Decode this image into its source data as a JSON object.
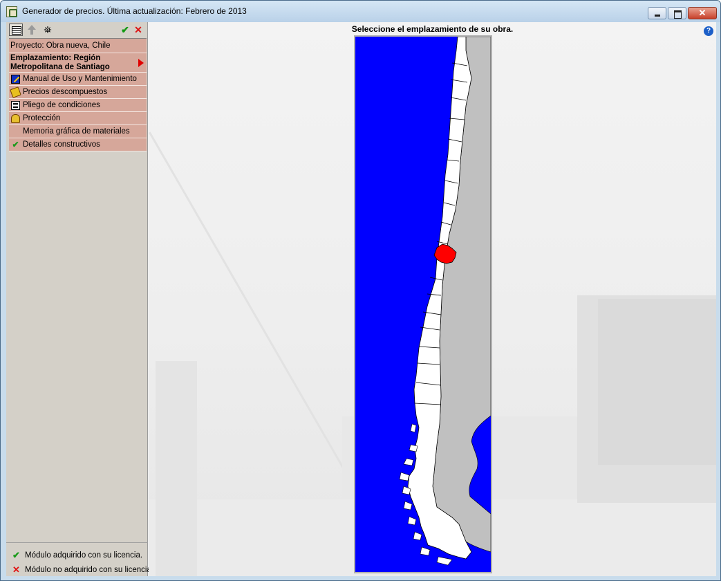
{
  "window": {
    "title": "Generador de precios. Última actualización: Febrero de 2013",
    "close_label": "✕"
  },
  "toolbar": {
    "find_glyph": "⛯",
    "ok_glyph": "✔",
    "cancel_glyph": "✕"
  },
  "menu": {
    "proyecto": "Proyecto: Obra nueva, Chile",
    "emplazamiento": "Emplazamiento: Región Metropolitana de Santiago",
    "items": [
      {
        "label": "Manual de Uso y Mantenimiento",
        "icon": "manual-icon"
      },
      {
        "label": "Precios descompuestos",
        "icon": "price-tag-icon"
      },
      {
        "label": "Pliego de condiciones",
        "icon": "document-icon"
      },
      {
        "label": "Protección",
        "icon": "helmet-icon"
      },
      {
        "label": "Memoria gráfica de materiales",
        "icon": ""
      },
      {
        "label": "Detalles constructivos",
        "icon": "check-icon"
      }
    ]
  },
  "legend": {
    "acquired": "Módulo adquirido con su licencia.",
    "not_acquired": "Módulo no adquirido con su licencia.",
    "acquired_symbol": "✔",
    "not_acquired_symbol": "✕"
  },
  "main": {
    "title": "Seleccione el emplazamiento de su obra.",
    "help_symbol": "?"
  },
  "map": {
    "country": "Chile",
    "selected_region": "Región Metropolitana de Santiago",
    "colors": {
      "sea": "#0000ff",
      "land": "#ffffff",
      "neighbor": "#c0c0c0",
      "selected": "#ff0000"
    }
  }
}
